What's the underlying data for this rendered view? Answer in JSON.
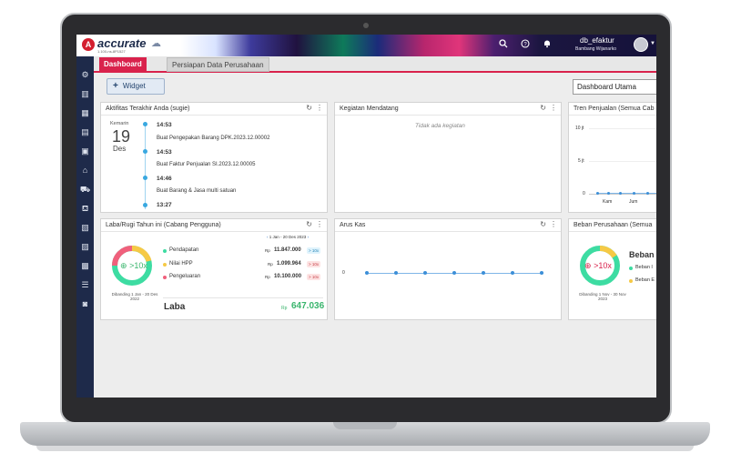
{
  "app": {
    "logo_text": "accurate",
    "logo_sub": "1.100-ns-8P1527",
    "user_name": "db_efaktur",
    "user_sub": "Bambang Wijanarko"
  },
  "tabs": [
    {
      "label": "Dashboard",
      "active": true
    },
    {
      "label": "Persiapan Data Perusahaan",
      "active": false
    }
  ],
  "toolbar": {
    "widget_label": "Widget",
    "dashboard_select": "Dashboard Utama"
  },
  "activity": {
    "title": "Aktifitas Terakhir Anda (sugie)",
    "date_caption": "Kemarin",
    "day": "19",
    "month": "Des",
    "items": [
      {
        "time": "14:53",
        "desc": "Buat Pengepakan Barang DPK.2023.12.00002"
      },
      {
        "time": "14:53",
        "desc": "Buat Faktur Penjualan SI.2023.12.00005"
      },
      {
        "time": "14:46",
        "desc": "Buat Barang & Jasa multi satuan"
      },
      {
        "time": "13:27",
        "desc": ""
      }
    ]
  },
  "upcoming": {
    "title": "Kegiatan Mendatang",
    "empty": "Tidak ada kegiatan"
  },
  "sales_trend": {
    "title": "Tren Penjualan (Semua Cab",
    "y_ticks": [
      "10 jt",
      "5 jt",
      "0"
    ],
    "x_ticks": [
      "Kam",
      "Jum"
    ]
  },
  "profit": {
    "title": "Laba/Rugi Tahun ini (Cabang Pengguna)",
    "range": "1 Jan - 20 Des 2023",
    "ring_label": ">10x",
    "compare": "Dibanding 1 Jan - 20 Des 2022",
    "rows": [
      {
        "label": "Pendapatan",
        "currency": "Rp",
        "value": "11.847.000",
        "tag": "> 10x"
      },
      {
        "label": "Nilai HPP",
        "currency": "Rp",
        "value": "1.099.964",
        "tag": "> 10x"
      },
      {
        "label": "Pengeluaran",
        "currency": "Rp",
        "value": "10.100.000",
        "tag": "> 10x"
      }
    ],
    "result_label": "Laba",
    "result_currency": "Rp",
    "result_value": "647.036"
  },
  "cashflow": {
    "title": "Arus Kas",
    "y_tick": "0"
  },
  "expense": {
    "title": "Beban Perusahaan (Semua",
    "ring_label": ">10x",
    "compare": "Dibanding 1 Nov - 30 Nov 2023",
    "heading": "Beban",
    "rows": [
      "Beban I",
      "Beban E"
    ]
  },
  "colors": {
    "accent": "#d9224c",
    "sidebar": "#1e2a4a",
    "green": "#3ac46c",
    "timeline": "#39a8e0"
  }
}
